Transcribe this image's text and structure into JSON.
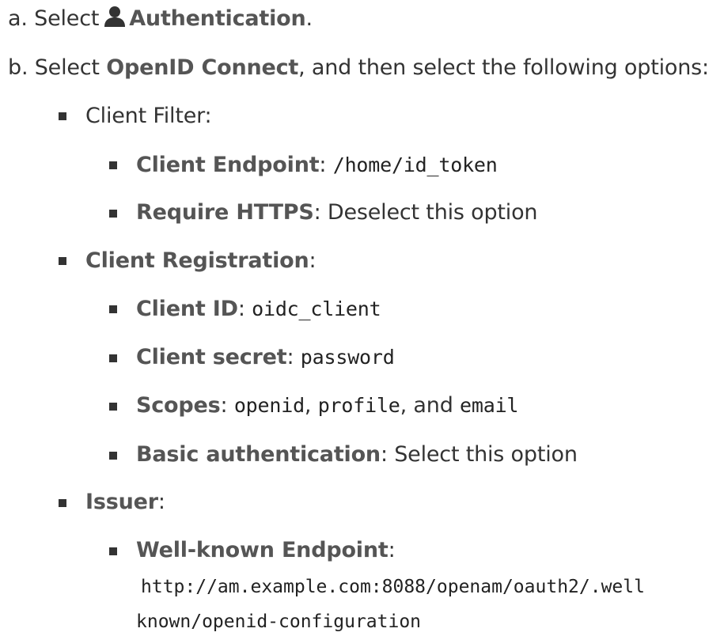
{
  "step_a": {
    "marker": "a.",
    "prefix": "Select",
    "icon": "user-icon",
    "target": "Authentication",
    "suffix": "."
  },
  "step_b": {
    "marker": "b.",
    "prefix": "Select",
    "target": "OpenID Connect",
    "suffix": ", and then select the following options:"
  },
  "client_filter": {
    "label": "Client Filter:",
    "endpoint": {
      "name": "Client Endpoint",
      "sep": ":",
      "value": "/home/id_token"
    },
    "https": {
      "name": "Require HTTPS",
      "text": ": Deselect this option"
    }
  },
  "client_registration": {
    "label": "Client Registration",
    "sep": ":",
    "client_id": {
      "name": "Client ID",
      "sep": ":",
      "value": "oidc_client"
    },
    "client_secret": {
      "name": "Client secret",
      "sep": ":",
      "value": "password"
    },
    "scopes": {
      "name": "Scopes",
      "sep": ":",
      "scope1": "openid",
      "comma": ",",
      "scope2": "profile",
      "and": ", and",
      "scope3": "email"
    },
    "basic_auth": {
      "name": "Basic authentication",
      "text": ": Select this option"
    }
  },
  "issuer": {
    "label": "Issuer",
    "sep": ":",
    "well_known": {
      "name": "Well-known Endpoint",
      "sep": ":",
      "value_line1": "http://am.example.com:8088/openam/oauth2/.well",
      "value_line2": "known/openid-configuration"
    }
  }
}
